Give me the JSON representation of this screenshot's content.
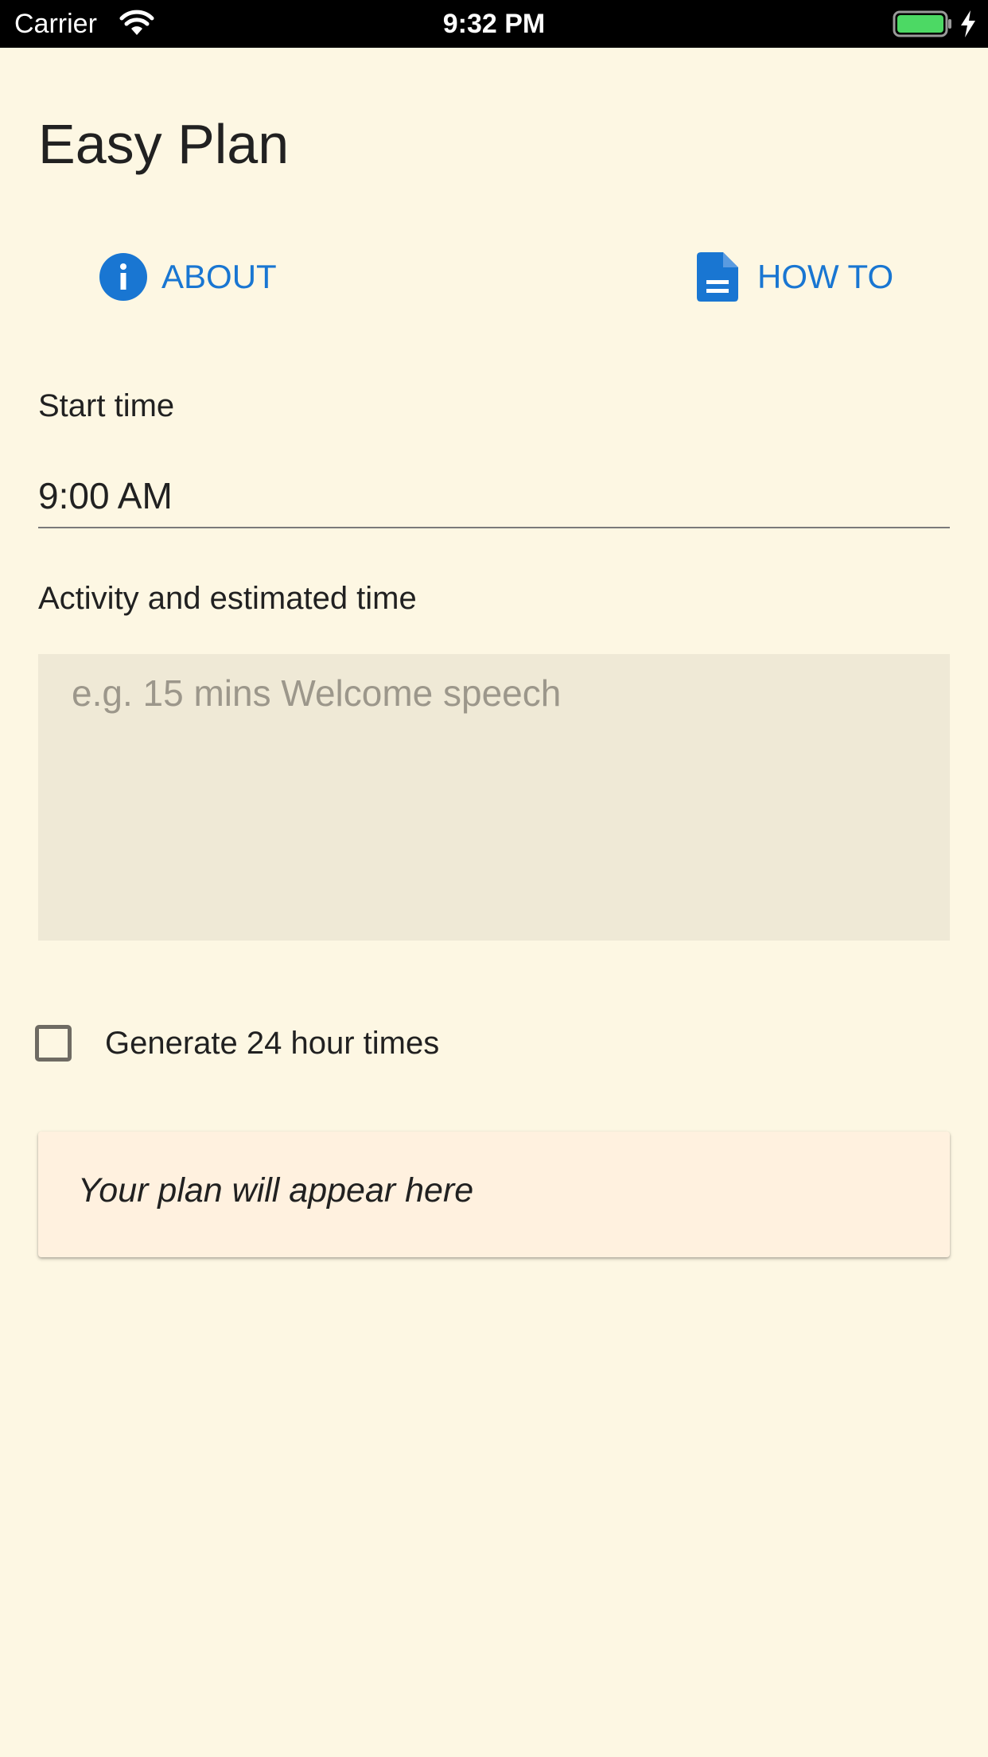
{
  "status_bar": {
    "carrier": "Carrier",
    "time": "9:32 PM",
    "icons": [
      "wifi-icon",
      "battery-icon",
      "charging-icon"
    ],
    "battery_color": "#4cd964"
  },
  "app": {
    "title": "Easy Plan",
    "background_color": "#fdf7e3",
    "accent_color": "#1976d2"
  },
  "nav": {
    "about": {
      "label": "ABOUT",
      "icon": "info-icon"
    },
    "how_to": {
      "label": "HOW TO",
      "icon": "document-icon"
    }
  },
  "form": {
    "start_time": {
      "label": "Start time",
      "value": "9:00 AM"
    },
    "activity": {
      "label": "Activity and estimated time",
      "value": "",
      "placeholder": "e.g. 15 mins Welcome speech"
    },
    "generate_24h": {
      "label": "Generate 24 hour times",
      "checked": false
    }
  },
  "plan": {
    "placeholder_text": "Your plan will appear here"
  }
}
